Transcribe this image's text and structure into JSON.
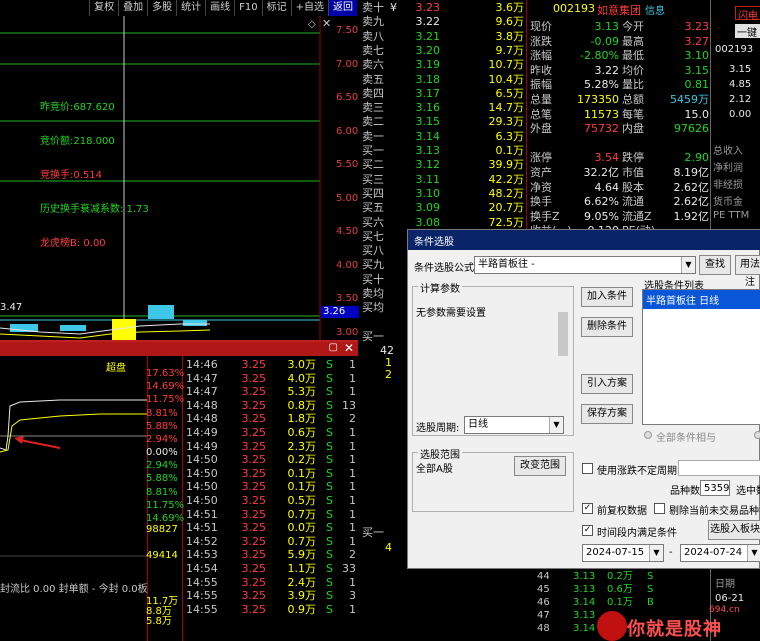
{
  "toolbar": {
    "items": [
      "复权",
      "叠加",
      "多股",
      "统计",
      "画线",
      "F10",
      "标记",
      "+自选",
      "返回"
    ],
    "active_index": 8
  },
  "kchart": {
    "y_labels": [
      "7.50",
      "7.00",
      "6.50",
      "6.00",
      "5.50",
      "5.00",
      "4.50",
      "4.00",
      "3.50",
      "3.00"
    ],
    "current_price_tag": "3.26",
    "left_price_label": "3.47",
    "stats": [
      {
        "label": "昨竞价:687.620",
        "color": "#22d322"
      },
      {
        "label": "竞价额:218.000",
        "color": "#22d322"
      },
      {
        "label": "竞换手:0.514",
        "color": "#ff3c3c"
      },
      {
        "label": "历史换手衰减系数: 1.73",
        "color": "#22d322"
      },
      {
        "label": "龙虎榜B: 0.00",
        "color": "#ff3c3c"
      }
    ],
    "icons": [
      "diamond-icon",
      "close-icon"
    ]
  },
  "order_book": {
    "rows": [
      {
        "label": "卖十",
        "price": "3.23",
        "vol": "3.6万",
        "color": "#ff3c3c",
        "suffix": "¥"
      },
      {
        "label": "卖九",
        "price": "3.22",
        "vol": "9.6万",
        "color": "#e8e8e8",
        "suffix": ""
      },
      {
        "label": "卖八",
        "price": "3.21",
        "vol": "3.8万",
        "color": "#22d322",
        "suffix": ""
      },
      {
        "label": "卖七",
        "price": "3.20",
        "vol": "9.7万",
        "color": "#22d322",
        "suffix": ""
      },
      {
        "label": "卖六",
        "price": "3.19",
        "vol": "10.7万",
        "color": "#22d322",
        "suffix": ""
      },
      {
        "label": "卖五",
        "price": "3.18",
        "vol": "10.4万",
        "color": "#22d322",
        "suffix": ""
      },
      {
        "label": "卖四",
        "price": "3.17",
        "vol": "6.5万",
        "color": "#22d322",
        "suffix": ""
      },
      {
        "label": "卖三",
        "price": "3.16",
        "vol": "14.7万",
        "color": "#22d322",
        "suffix": ""
      },
      {
        "label": "卖二",
        "price": "3.15",
        "vol": "29.3万",
        "color": "#22d322",
        "suffix": ""
      },
      {
        "label": "卖一",
        "price": "3.14",
        "vol": "6.3万",
        "color": "#22d322",
        "suffix": ""
      },
      {
        "label": "买一",
        "price": "3.13",
        "vol": "0.1万",
        "color": "#22d322",
        "suffix": ""
      },
      {
        "label": "买二",
        "price": "3.12",
        "vol": "39.9万",
        "color": "#22d322",
        "suffix": ""
      },
      {
        "label": "买三",
        "price": "3.11",
        "vol": "42.2万",
        "color": "#22d322",
        "suffix": ""
      },
      {
        "label": "买四",
        "price": "3.10",
        "vol": "48.2万",
        "color": "#22d322",
        "suffix": ""
      },
      {
        "label": "买五",
        "price": "3.09",
        "vol": "20.7万",
        "color": "#22d322",
        "suffix": ""
      },
      {
        "label": "买六",
        "price": "3.08",
        "vol": "72.5万",
        "color": "#22d322",
        "suffix": ""
      },
      {
        "label": "买七",
        "price": "",
        "vol": "",
        "color": "#22d322",
        "suffix": ""
      },
      {
        "label": "买八",
        "price": "",
        "vol": "",
        "color": "#22d322",
        "suffix": ""
      },
      {
        "label": "买九",
        "price": "",
        "vol": "",
        "color": "#22d322",
        "suffix": ""
      },
      {
        "label": "买十",
        "price": "",
        "vol": "",
        "color": "#22d322",
        "suffix": ""
      },
      {
        "label": "卖均",
        "price": "",
        "vol": "",
        "color": "#22d322",
        "suffix": ""
      },
      {
        "label": "买均",
        "price": "",
        "vol": "",
        "color": "#22d322",
        "suffix": ""
      }
    ],
    "lower_label": "买一",
    "lower_vals": [
      "42",
      "1",
      "2"
    ],
    "lower_label2": "买一",
    "lower_val2": "4"
  },
  "quote": {
    "code": "002193",
    "name": "如意集团",
    "tag": "信息",
    "rows": [
      {
        "l1": "现价",
        "v1": "3.13",
        "v1c": "#22d322",
        "s1": "今开",
        "l2": "",
        "v2": "3.23",
        "v2c": "#ff3c3c"
      },
      {
        "l1": "涨跌",
        "v1": "-0.09",
        "v1c": "#22d322",
        "s1": "",
        "l2": "最高",
        "v2": "3.27",
        "v2c": "#ff3c3c"
      },
      {
        "l1": "涨幅",
        "v1": "-2.80%",
        "v1c": "#22d322",
        "s1": "",
        "l2": "最低",
        "v2": "3.10",
        "v2c": "#22d322"
      },
      {
        "l1": "昨收",
        "v1": "3.22",
        "v1c": "#e8e8e8",
        "s1": "",
        "l2": "均价",
        "v2": "3.15",
        "v2c": "#22d322"
      },
      {
        "l1": "振幅",
        "v1": "5.28%",
        "v1c": "#e8e8e8",
        "s1": "",
        "l2": "量比",
        "v2": "0.81",
        "v2c": "#22d322"
      },
      {
        "l1": "总量",
        "v1": "173350",
        "v1c": "#ffff00",
        "s1": "",
        "l2": "总额",
        "v2": "5459万",
        "v2c": "#3ec7e6"
      },
      {
        "l1": "总笔",
        "v1": "11573",
        "v1c": "#ffff00",
        "s1": "",
        "l2": "每笔",
        "v2": "15.0",
        "v2c": "#e8e8e8"
      },
      {
        "l1": "外盘",
        "v1": "75732",
        "v1c": "#ff3c3c",
        "s1": "",
        "l2": "内盘",
        "v2": "97626",
        "v2c": "#22d322"
      },
      {
        "l1": "",
        "v1": "",
        "v1c": "#e8e8e8",
        "s1": "",
        "l2": "",
        "v2": "",
        "v2c": "#e8e8e8"
      },
      {
        "l1": "涨停",
        "v1": "3.54",
        "v1c": "#ff3c3c",
        "s1": "",
        "l2": "跌停",
        "v2": "2.90",
        "v2c": "#22d322"
      },
      {
        "l1": "资产",
        "v1": "32.2亿",
        "v1c": "#e8e8e8",
        "s1": "",
        "l2": "市值",
        "v2": "8.19亿",
        "v2c": "#e8e8e8"
      },
      {
        "l1": "净资",
        "v1": "4.64",
        "v1c": "#e8e8e8",
        "s1": "",
        "l2": "股本",
        "v2": "2.62亿",
        "v2c": "#e8e8e8"
      },
      {
        "l1": "换手",
        "v1": "6.62%",
        "v1c": "#e8e8e8",
        "s1": "",
        "l2": "流通",
        "v2": "2.62亿",
        "v2c": "#e8e8e8"
      },
      {
        "l1": "换手Z",
        "v1": "9.05%",
        "v1c": "#e8e8e8",
        "s1": "",
        "l2": "流通Z",
        "v2": "1.92亿",
        "v2c": "#e8e8e8"
      },
      {
        "l1": "收益(一)",
        "v1": "-0.120",
        "v1c": "#e8e8e8",
        "s1": "",
        "l2": "PE(动)",
        "v2": "-",
        "v2c": "#e8e8e8"
      }
    ]
  },
  "far_right": {
    "tag1": "闪电王",
    "tag2": "一键",
    "code": "002193",
    "vals": [
      "3.15",
      "4.85",
      "2.12",
      "0.00"
    ],
    "labels": [
      "总收入",
      "净利润",
      "非经损",
      "货币金",
      "PE TTM"
    ]
  },
  "intraday": {
    "label_chaopan": "超盘",
    "pct_labels": [
      {
        "t": "17.63%",
        "c": "#ff3c3c"
      },
      {
        "t": "14.69%",
        "c": "#ff3c3c"
      },
      {
        "t": "11.75%",
        "c": "#ff3c3c"
      },
      {
        "t": "8.81%",
        "c": "#ff3c3c"
      },
      {
        "t": "5.88%",
        "c": "#ff3c3c"
      },
      {
        "t": "2.94%",
        "c": "#ff3c3c"
      },
      {
        "t": "0.00%",
        "c": "#e8e8e8"
      },
      {
        "t": "2.94%",
        "c": "#22d322"
      },
      {
        "t": "5.88%",
        "c": "#22d322"
      },
      {
        "t": "8.81%",
        "c": "#22d322"
      },
      {
        "t": "11.75%",
        "c": "#22d322"
      },
      {
        "t": "14.69%",
        "c": "#22d322"
      },
      {
        "t": "98827",
        "c": "#ffff00"
      },
      {
        "t": "49414",
        "c": "#ffff00"
      }
    ],
    "footer": "封流比 0.00  封单额 - 今封 0.0板",
    "vol_labels": [
      "11.7万",
      "8.8万",
      "5.8万"
    ],
    "ticks": [
      {
        "t": "14:46",
        "p": "3.25",
        "v": "3.0万",
        "s": "S",
        "n": "1"
      },
      {
        "t": "14:47",
        "p": "3.25",
        "v": "4.0万",
        "s": "S",
        "n": "1"
      },
      {
        "t": "14:47",
        "p": "3.25",
        "v": "5.3万",
        "s": "S",
        "n": "1"
      },
      {
        "t": "14:48",
        "p": "3.25",
        "v": "0.8万",
        "s": "S",
        "n": "13"
      },
      {
        "t": "14:48",
        "p": "3.25",
        "v": "1.8万",
        "s": "S",
        "n": "2"
      },
      {
        "t": "14:49",
        "p": "3.25",
        "v": "0.6万",
        "s": "S",
        "n": "1"
      },
      {
        "t": "14:49",
        "p": "3.25",
        "v": "2.3万",
        "s": "S",
        "n": "1"
      },
      {
        "t": "14:50",
        "p": "3.25",
        "v": "0.2万",
        "s": "S",
        "n": "1"
      },
      {
        "t": "14:50",
        "p": "3.25",
        "v": "0.1万",
        "s": "S",
        "n": "1"
      },
      {
        "t": "14:50",
        "p": "3.25",
        "v": "0.1万",
        "s": "S",
        "n": "1"
      },
      {
        "t": "14:50",
        "p": "3.25",
        "v": "0.5万",
        "s": "S",
        "n": "1"
      },
      {
        "t": "14:51",
        "p": "3.25",
        "v": "0.7万",
        "s": "S",
        "n": "1"
      },
      {
        "t": "14:51",
        "p": "3.25",
        "v": "0.0万",
        "s": "S",
        "n": "1"
      },
      {
        "t": "14:52",
        "p": "3.25",
        "v": "0.7万",
        "s": "S",
        "n": "1"
      },
      {
        "t": "14:53",
        "p": "3.25",
        "v": "5.9万",
        "s": "S",
        "n": "2"
      },
      {
        "t": "14:54",
        "p": "3.25",
        "v": "1.1万",
        "s": "S",
        "n": "33"
      },
      {
        "t": "14:55",
        "p": "3.25",
        "v": "2.4万",
        "s": "S",
        "n": "1"
      },
      {
        "t": "14:55",
        "p": "3.25",
        "v": "3.9万",
        "s": "S",
        "n": "3"
      },
      {
        "t": "14:55",
        "p": "3.25",
        "v": "0.9万",
        "s": "S",
        "n": "1"
      }
    ]
  },
  "dialog": {
    "title": "条件选股",
    "formula_label": "条件选股公式",
    "formula_value": "半路首板往  -",
    "btn_find": "查找",
    "btn_usage": "用法注",
    "group_calc": "计算参数",
    "no_params": "无参数需要设置",
    "btn_add": "加入条件",
    "btn_delete": "删除条件",
    "list_title": "选股条件列表",
    "list_items": [
      "半路首板往  日线"
    ],
    "btn_import": "引入方案",
    "btn_save": "保存方案",
    "period_label": "选股周期:",
    "period_value": "日线",
    "radio_all": "全部条件相与",
    "group_range": "选股范围",
    "range_value": "全部A股",
    "btn_change_range": "改变范围",
    "chk_uncertain_label": "使用涨跌不定周期",
    "count_label": "品种数",
    "count_value": "5359",
    "selected_label": "选中数",
    "chk_prerights_label": "前复权数据",
    "chk_exclude_label": "剔除当前未交易品种",
    "chk_period_label": "时间段内满足条件",
    "btn_add_board": "选股入板块",
    "date_from": "2024-07-15",
    "date_sep": "-",
    "date_to": "2024-07-24"
  },
  "bottom_right": {
    "rows": [
      {
        "a": "44",
        "b": "3.13",
        "c": "0.2万",
        "d": "S"
      },
      {
        "a": "45",
        "b": "3.13",
        "c": "0.6万",
        "d": "S"
      },
      {
        "a": "46",
        "b": "3.14",
        "c": "0.1万",
        "d": "B"
      },
      {
        "a": "47",
        "b": "3.13",
        "c": "",
        "d": ""
      },
      {
        "a": "48",
        "b": "3.14",
        "c": "",
        "d": ""
      }
    ],
    "label_date": "日期",
    "date_value": "06-21",
    "watermark": "你就是股神",
    "watermark_url": "694.cn"
  }
}
